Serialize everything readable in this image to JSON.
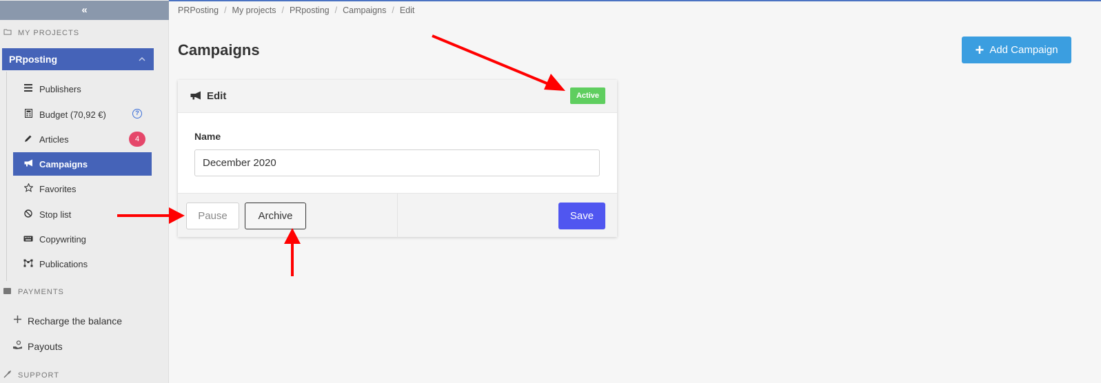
{
  "sidebar": {
    "collapse_glyph": "«",
    "my_projects_title": "MY PROJECTS",
    "project_name": "PRposting",
    "items": [
      {
        "label": "Publishers",
        "icon": "list-icon"
      },
      {
        "label": "Budget (70,92 €)",
        "icon": "calculator-icon",
        "help": "?"
      },
      {
        "label": "Articles",
        "icon": "pencil-icon",
        "count": "4"
      },
      {
        "label": "Campaigns",
        "icon": "megaphone-icon"
      },
      {
        "label": "Favorites",
        "icon": "star-icon"
      },
      {
        "label": "Stop list",
        "icon": "ban-icon"
      },
      {
        "label": "Copywriting",
        "icon": "keyboard-icon"
      },
      {
        "label": "Publications",
        "icon": "network-icon"
      }
    ],
    "payments_title": "PAYMENTS",
    "payments_items": [
      {
        "label": "Recharge the balance",
        "icon": "plus-icon"
      },
      {
        "label": "Payouts",
        "icon": "hand-coin-icon"
      }
    ],
    "support_title": "SUPPORT"
  },
  "breadcrumb": [
    "PRPosting",
    "My projects",
    "PRposting",
    "Campaigns",
    "Edit"
  ],
  "page_title": "Campaigns",
  "add_campaign_label": "Add Campaign",
  "card": {
    "title": "Edit",
    "status": "Active",
    "name_label": "Name",
    "name_value": "December 2020",
    "pause_label": "Pause",
    "archive_label": "Archive",
    "save_label": "Save"
  },
  "colors": {
    "accent": "#4563b8",
    "badge_active": "#5fce5f",
    "save": "#5056f0",
    "add_button": "#3b9ee0",
    "annotation_arrow": "#ff0000"
  }
}
